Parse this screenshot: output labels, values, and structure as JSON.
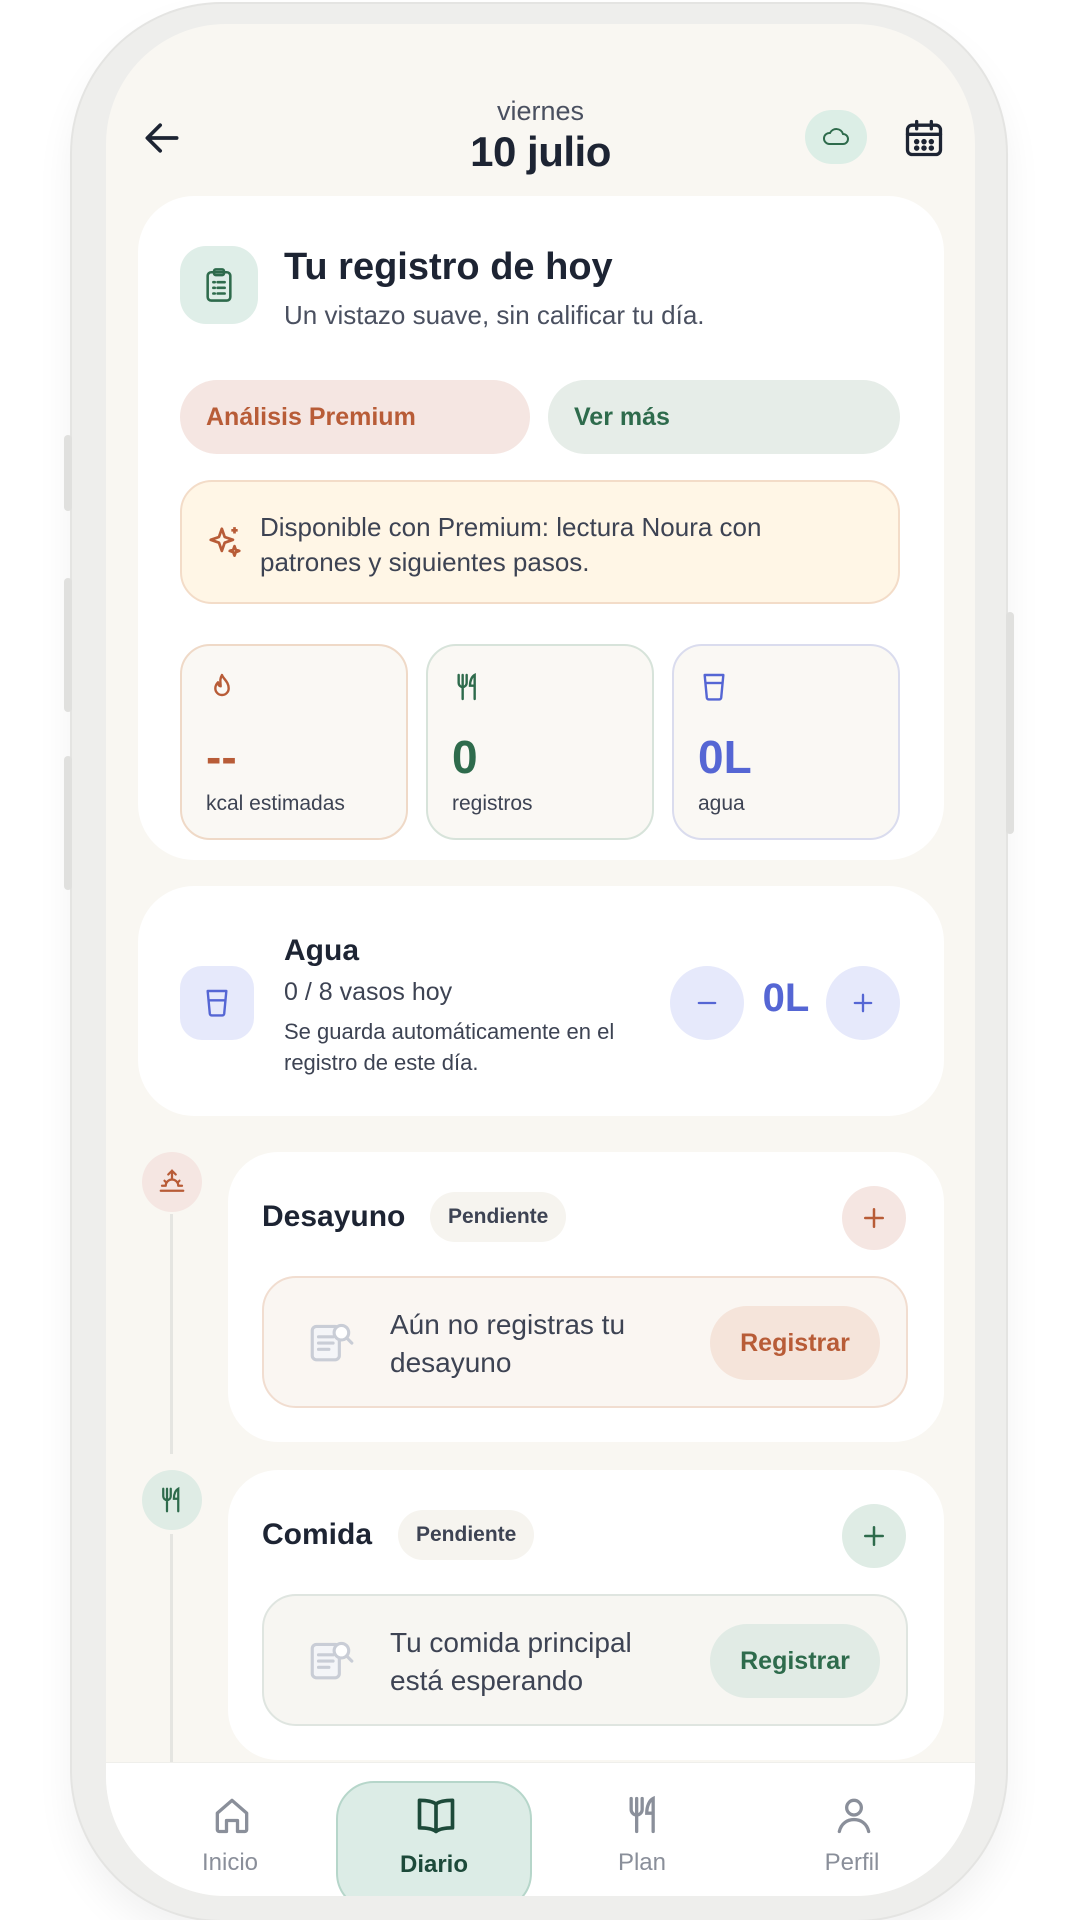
{
  "header": {
    "day": "viernes",
    "date": "10 julio"
  },
  "summary": {
    "title": "Tu registro de hoy",
    "subtitle": "Un vistazo suave, sin calificar tu día.",
    "premium_button": "Análisis Premium",
    "more_button": "Ver más",
    "notice": "Disponible con Premium: lectura Noura con patrones y siguientes pasos.",
    "stats": [
      {
        "value": "--",
        "label": "kcal estimadas",
        "icon": "flame-icon",
        "color": "#b85c37"
      },
      {
        "value": "0",
        "label": "registros",
        "icon": "fork-knife-icon",
        "color": "#2e6b4c"
      },
      {
        "value": "0L",
        "label": "agua",
        "icon": "glass-icon",
        "color": "#5566d4"
      }
    ]
  },
  "water": {
    "title": "Agua",
    "count": "0 / 8 vasos hoy",
    "note": "Se guarda automáticamente en el registro de este día.",
    "value": "0L",
    "minus": "−",
    "plus": "+"
  },
  "meals": [
    {
      "title": "Desayuno",
      "status": "Pendiente",
      "empty_text": "Aún no registras tu desayuno",
      "action": "Registrar",
      "icon": "sunrise-icon",
      "accent": "#b85c37"
    },
    {
      "title": "Comida",
      "status": "Pendiente",
      "empty_text": "Tu comida principal está esperando",
      "action": "Registrar",
      "icon": "fork-knife-icon",
      "accent": "#2e6b4c"
    }
  ],
  "nav": [
    {
      "label": "Inicio",
      "icon": "home-icon",
      "active": false
    },
    {
      "label": "Diario",
      "icon": "book-icon",
      "active": true
    },
    {
      "label": "Plan",
      "icon": "fork-knife-icon",
      "active": false
    },
    {
      "label": "Perfil",
      "icon": "user-icon",
      "active": false
    }
  ]
}
